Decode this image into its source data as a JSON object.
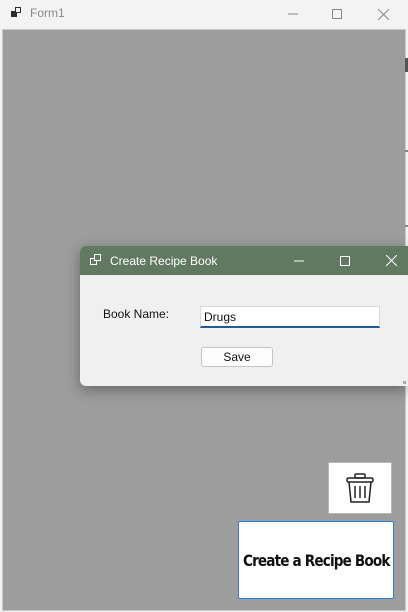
{
  "main_window": {
    "title": "Form1",
    "icon": "app-window-icon",
    "controls": [
      "minimize-icon",
      "maximize-icon",
      "close-icon"
    ]
  },
  "dialog": {
    "title": "Create Recipe Book",
    "icon": "app-window-icon",
    "controls": [
      "minimize-icon",
      "maximize-icon",
      "close-icon"
    ],
    "book_name_label": "Book Name:",
    "book_name_value": "Drugs",
    "save_label": "Save"
  },
  "main": {
    "trash_icon": "trash-icon",
    "create_button_label": "Create a Recipe Book"
  },
  "colors": {
    "dialog_titlebar": "#617861",
    "client_background": "#9d9d9d",
    "accent_border": "#2f7fd1"
  }
}
